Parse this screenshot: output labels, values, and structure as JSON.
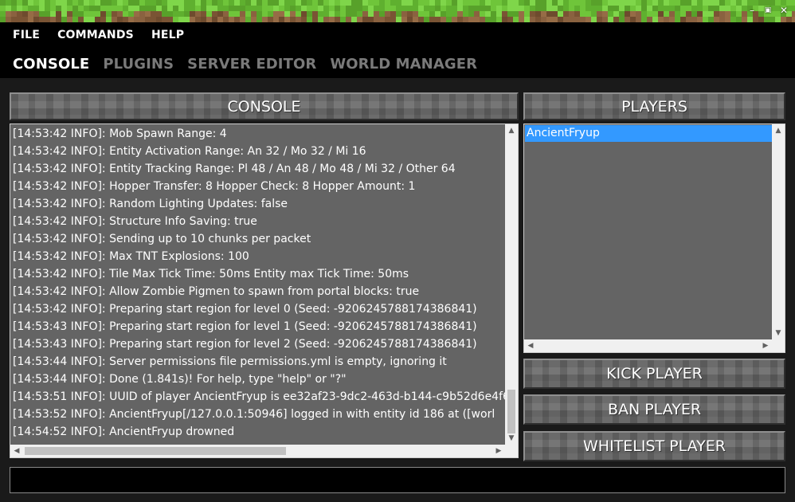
{
  "window": {
    "controls": [
      {
        "name": "minimize",
        "glyph": "–"
      },
      {
        "name": "restore",
        "glyph": "▣"
      },
      {
        "name": "close",
        "glyph": "✕"
      }
    ]
  },
  "menu": [
    "FILE",
    "COMMANDS",
    "HELP"
  ],
  "tabs": [
    {
      "label": "CONSOLE",
      "active": true
    },
    {
      "label": "PLUGINS",
      "active": false
    },
    {
      "label": "SERVER EDITOR",
      "active": false
    },
    {
      "label": "WORLD MANAGER",
      "active": false
    }
  ],
  "console": {
    "title": "CONSOLE",
    "lines": [
      "[14:53:42 INFO]: Mob Spawn Range: 4",
      "[14:53:42 INFO]: Entity Activation Range: An 32 / Mo 32 / Mi 16",
      "[14:53:42 INFO]: Entity Tracking Range: Pl 48 / An 48 / Mo 48 / Mi 32 / Other 64",
      "[14:53:42 INFO]: Hopper Transfer: 8 Hopper Check: 8 Hopper Amount: 1",
      "[14:53:42 INFO]: Random Lighting Updates: false",
      "[14:53:42 INFO]: Structure Info Saving: true",
      "[14:53:42 INFO]: Sending up to 10 chunks per packet",
      "[14:53:42 INFO]: Max TNT Explosions: 100",
      "[14:53:42 INFO]: Tile Max Tick Time: 50ms Entity max Tick Time: 50ms",
      "[14:53:42 INFO]: Allow Zombie Pigmen to spawn from portal blocks: true",
      "[14:53:42 INFO]: Preparing start region for level 0 (Seed: -9206245788174386841)",
      "[14:53:43 INFO]: Preparing start region for level 1 (Seed: -9206245788174386841)",
      "[14:53:43 INFO]: Preparing start region for level 2 (Seed: -9206245788174386841)",
      "[14:53:44 INFO]: Server permissions file permissions.yml is empty, ignoring it",
      "[14:53:44 INFO]: Done (1.841s)! For help, type \"help\" or \"?\"",
      "[14:53:51 INFO]: UUID of player AncientFryup is ee32af23-9dc2-463d-b144-c9b52d6e4f6",
      "[14:53:52 INFO]: AncientFryup[/127.0.0.1:50946] logged in with entity id 186 at ([worl",
      "[14:54:52 INFO]: AncientFryup drowned"
    ]
  },
  "players": {
    "title": "PLAYERS",
    "list": [
      "AncientFryup"
    ]
  },
  "actions": {
    "kick": "KICK PLAYER",
    "ban": "BAN PLAYER",
    "whitelist": "WHITELIST PLAYER"
  },
  "command": {
    "value": "",
    "placeholder": ""
  },
  "colors": {
    "grass": "#6fc53a",
    "dirt": "#8a6240",
    "stone": "#6a6a6a",
    "selection": "#3399ff",
    "panel": "#646464"
  },
  "icons": {
    "scroll_up": "▲",
    "scroll_down": "▼",
    "scroll_left": "◀",
    "scroll_right": "▶"
  }
}
